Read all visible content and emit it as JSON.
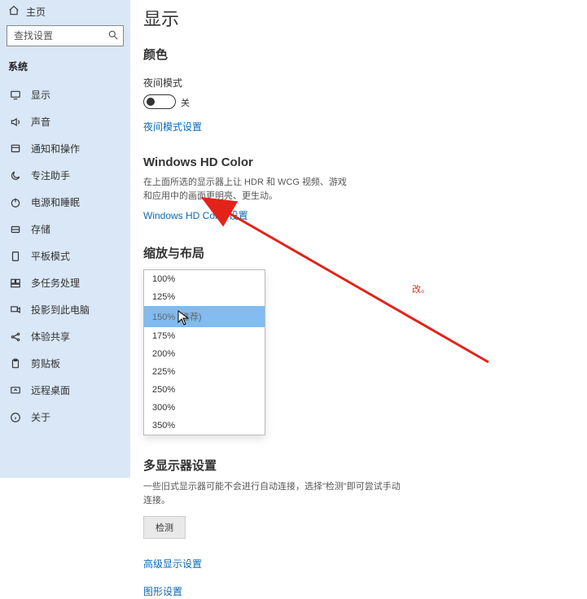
{
  "sidebar": {
    "home": "主页",
    "search_placeholder": "查找设置",
    "section_label": "系统",
    "items": [
      {
        "label": "显示"
      },
      {
        "label": "声音"
      },
      {
        "label": "通知和操作"
      },
      {
        "label": "专注助手"
      },
      {
        "label": "电源和睡眠"
      },
      {
        "label": "存储"
      },
      {
        "label": "平板模式"
      },
      {
        "label": "多任务处理"
      },
      {
        "label": "投影到此电脑"
      },
      {
        "label": "体验共享"
      },
      {
        "label": "剪贴板"
      },
      {
        "label": "远程桌面"
      },
      {
        "label": "关于"
      }
    ]
  },
  "content": {
    "page_title": "显示",
    "color_heading": "颜色",
    "night_light_label": "夜间模式",
    "toggle_state": "关",
    "night_light_link": "夜间模式设置",
    "hd_heading": "Windows HD Color",
    "hd_desc": "在上面所选的显示器上让 HDR 和 WCG 视频、游戏和应用中的画面更明亮、更生动。",
    "hd_link": "Windows HD Color 设置",
    "scale_heading": "缩放与布局",
    "scale_options": [
      "100%",
      "125%",
      "150% (推荐)",
      "175%",
      "200%",
      "225%",
      "250%",
      "300%",
      "350%"
    ],
    "scale_selected_index": 2,
    "scale_peek_text": "改。",
    "multi_heading": "多显示器设置",
    "multi_desc": "一些旧式显示器可能不会进行自动连接，选择\"检测\"即可尝试手动连接。",
    "detect_button": "检测",
    "adv_link": "高级显示设置",
    "graphics_link": "图形设置"
  }
}
